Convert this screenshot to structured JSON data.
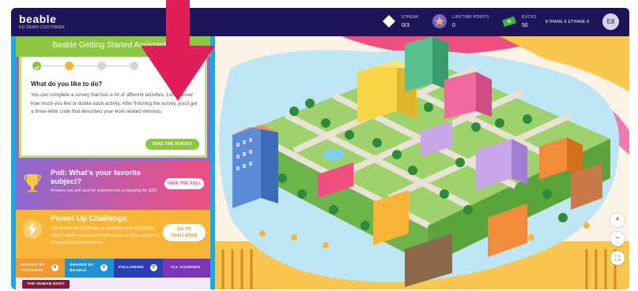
{
  "app": {
    "logo": "beable",
    "subtitle": "ED DEMO CUSTOMER"
  },
  "stats": {
    "streak": {
      "label": "STREAK",
      "value": "0/3"
    },
    "lifetime_points": {
      "label": "LIFETIME POINTS",
      "value": "0"
    },
    "bucks": {
      "label": "BUCKS",
      "value": "50"
    }
  },
  "user": {
    "name": "ETHANE 8 ETHANE 8",
    "initials": "E8"
  },
  "assistant": {
    "title": "Beable Getting Started Assistant",
    "question_title": "What do you like to do?",
    "question_text": "You can complete a survey that lists a lot of different activities. Let us know how much you like or dislike each activity. After finishing the survey, you'll get a three-letter code that describes your work related interests.",
    "survey_button": "TAKE THE SURVEY"
  },
  "poll": {
    "title": "Poll: What's your favorite subject?",
    "text": "Answer our poll and be entered into a drawing for $25!",
    "button": "TAKE THE POLL"
  },
  "power_up": {
    "title": "Power Up Challenge",
    "text": "The Power Up Challenge is available until 8/31/2023. Take it when your teacher tells you to or when you think you can do your best work.",
    "button_line1": "GO TO",
    "button_line2": "CHALLENGE"
  },
  "tabs": [
    {
      "label1": "SHARED BY",
      "label2": "TEACHERS",
      "count": "0"
    },
    {
      "label1": "SHARED BY",
      "label2": "BEABLE",
      "count": "0"
    },
    {
      "label1": "FOLLOWING",
      "label2": "",
      "count": "0"
    },
    {
      "label1": "ALL COURSES",
      "label2": "",
      "count": ""
    }
  ],
  "course_chip": "THE HUMAN BODY",
  "map_controls": {
    "zoom_in": "+",
    "zoom_out": "−",
    "fullscreen": "⛶"
  },
  "colors": {
    "topbar": "#1d1557",
    "frame": "#1aa8e6",
    "assistant_green": "#8dc63f",
    "poll_pink": "#ee4f7e",
    "power_orange": "#f7b53a",
    "arrow": "#e01e5a"
  }
}
